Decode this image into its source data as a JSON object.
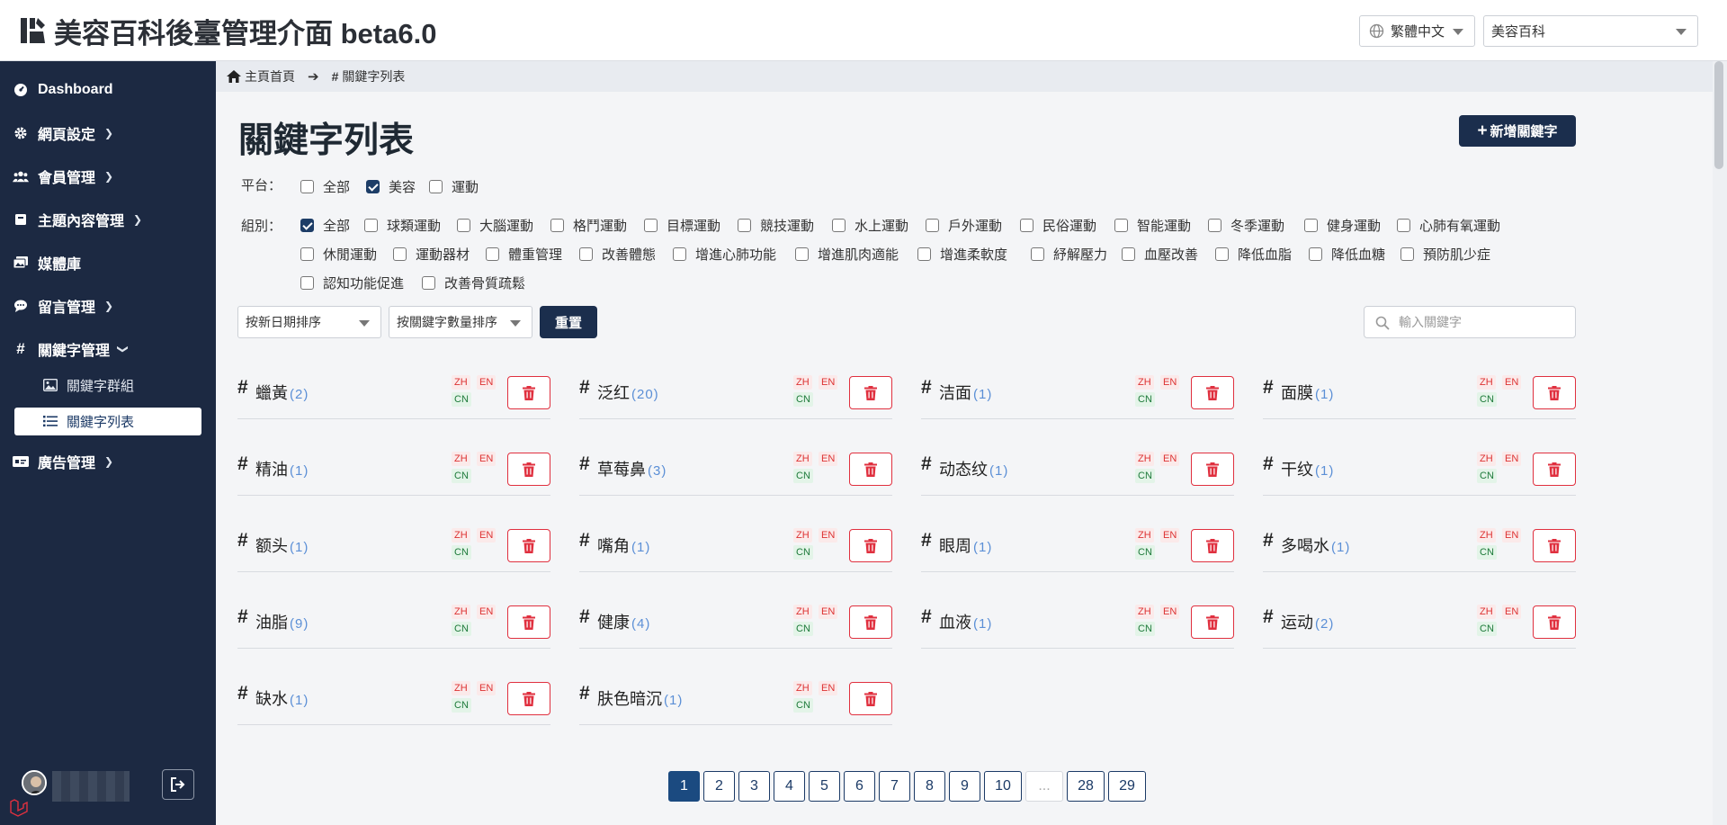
{
  "header": {
    "title": "美容百科後臺管理介面 beta6.0",
    "language": "繁體中文",
    "site": "美容百科"
  },
  "sidebar": {
    "items": [
      {
        "label": "Dashboard",
        "icon": "dashboard-icon"
      },
      {
        "label": "網頁設定",
        "icon": "gear-icon"
      },
      {
        "label": "會員管理",
        "icon": "users-icon"
      },
      {
        "label": "主題內容管理",
        "icon": "book-icon"
      },
      {
        "label": "媒體庫",
        "icon": "images-icon"
      },
      {
        "label": "留言管理",
        "icon": "comment-icon"
      },
      {
        "label": "關鍵字管理",
        "icon": "hash-icon"
      },
      {
        "label": "廣告管理",
        "icon": "ad-icon"
      }
    ],
    "subitems": [
      {
        "label": "關鍵字群組",
        "icon": "image-icon"
      },
      {
        "label": "關鍵字列表",
        "icon": "list-icon",
        "active": true
      }
    ]
  },
  "breadcrumb": {
    "home": "主頁首頁",
    "current": "關鍵字列表"
  },
  "page": {
    "title": "關鍵字列表",
    "add_button": "新增關鍵字"
  },
  "filters": {
    "platform_label": "平台：",
    "platforms": [
      {
        "label": "全部",
        "checked": false
      },
      {
        "label": "美容",
        "checked": true
      },
      {
        "label": "運動",
        "checked": false
      }
    ],
    "group_label": "組別：",
    "groups_row1": [
      {
        "label": "全部",
        "checked": true
      },
      {
        "label": "球類運動",
        "checked": false
      },
      {
        "label": "大腦運動",
        "checked": false
      },
      {
        "label": "格鬥運動",
        "checked": false
      },
      {
        "label": "目標運動",
        "checked": false
      },
      {
        "label": "競技運動",
        "checked": false
      },
      {
        "label": "水上運動",
        "checked": false
      },
      {
        "label": "戶外運動",
        "checked": false
      },
      {
        "label": "民俗運動",
        "checked": false
      },
      {
        "label": "智能運動",
        "checked": false
      },
      {
        "label": "冬季運動",
        "checked": false
      },
      {
        "label": "健身運動",
        "checked": false
      },
      {
        "label": "心肺有氧運動",
        "checked": false
      }
    ],
    "groups_row2": [
      {
        "label": "休閒運動",
        "checked": false
      },
      {
        "label": "運動器材",
        "checked": false
      },
      {
        "label": "體重管理",
        "checked": false
      },
      {
        "label": "改善體態",
        "checked": false
      },
      {
        "label": "增進心肺功能",
        "checked": false
      },
      {
        "label": "增進肌肉適能",
        "checked": false
      },
      {
        "label": "增進柔軟度",
        "checked": false
      },
      {
        "label": "紓解壓力",
        "checked": false
      },
      {
        "label": "血壓改善",
        "checked": false
      },
      {
        "label": "降低血脂",
        "checked": false
      },
      {
        "label": "降低血糖",
        "checked": false
      },
      {
        "label": "預防肌少症",
        "checked": false
      }
    ],
    "groups_row3": [
      {
        "label": "認知功能促進",
        "checked": false
      },
      {
        "label": "改善骨質疏鬆",
        "checked": false
      }
    ]
  },
  "toolbar": {
    "sort_date": "按新日期排序",
    "sort_count": "按關鍵字數量排序",
    "reset": "重置",
    "search_placeholder": "輸入關鍵字"
  },
  "keywords": [
    {
      "name": "蠟黃",
      "count": "(2)"
    },
    {
      "name": "泛红",
      "count": "(20)"
    },
    {
      "name": "洁面",
      "count": "(1)"
    },
    {
      "name": "面膜",
      "count": "(1)"
    },
    {
      "name": "精油",
      "count": "(1)"
    },
    {
      "name": "草莓鼻",
      "count": "(3)"
    },
    {
      "name": "动态纹",
      "count": "(1)"
    },
    {
      "name": "干纹",
      "count": "(1)"
    },
    {
      "name": "额头",
      "count": "(1)"
    },
    {
      "name": "嘴角",
      "count": "(1)"
    },
    {
      "name": "眼周",
      "count": "(1)"
    },
    {
      "name": "多喝水",
      "count": "(1)"
    },
    {
      "name": "油脂",
      "count": "(9)"
    },
    {
      "name": "健康",
      "count": "(4)"
    },
    {
      "name": "血液",
      "count": "(1)"
    },
    {
      "name": "运动",
      "count": "(2)"
    },
    {
      "name": "缺水",
      "count": "(1)"
    },
    {
      "name": "肤色暗沉",
      "count": "(1)"
    }
  ],
  "tags": {
    "zh": "ZH",
    "en": "EN",
    "cn": "CN"
  },
  "pagination": [
    "1",
    "2",
    "3",
    "4",
    "5",
    "6",
    "7",
    "8",
    "9",
    "10",
    "...",
    "28",
    "29"
  ],
  "current_page": "1",
  "colors": {
    "sidebar": "#1c2942",
    "primary": "#1b2e4d",
    "danger": "#e0303f",
    "count": "#5b8fd6"
  }
}
